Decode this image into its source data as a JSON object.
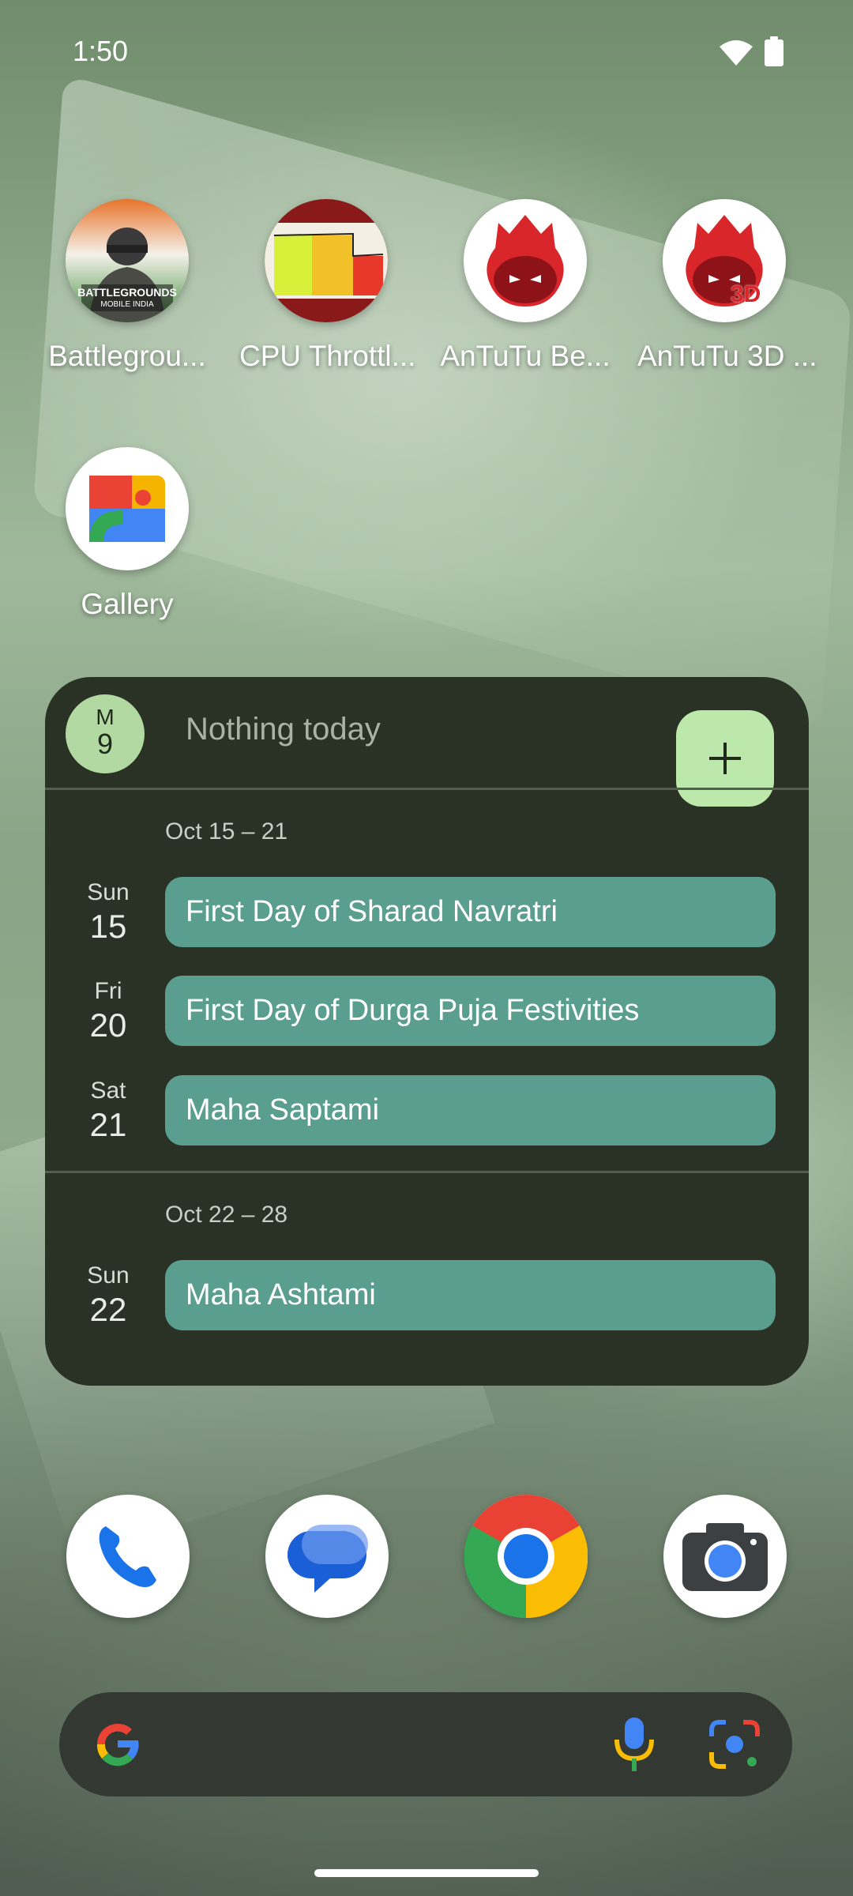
{
  "status_bar": {
    "time": "1:50"
  },
  "apps": [
    {
      "label": "Battlegrou...",
      "icon": "battlegrounds-icon",
      "icon_text_1": "BATTLEGROUNDS",
      "icon_text_2": "MOBILE INDIA"
    },
    {
      "label": "CPU Throttl...",
      "icon": "cpu-throttling-icon"
    },
    {
      "label": "AnTuTu Be...",
      "icon": "antutu-benchmark-icon"
    },
    {
      "label": "AnTuTu 3D ...",
      "icon": "antutu-3d-icon",
      "badge": "3D"
    },
    {
      "label": "Gallery",
      "icon": "gallery-icon"
    }
  ],
  "calendar": {
    "today_month": "M",
    "today_day": "9",
    "empty_text": "Nothing today",
    "add_icon": "plus-icon",
    "weeks": [
      {
        "range": "Oct 15 – 21",
        "days": [
          {
            "day_name": "Sun",
            "day_num": "15",
            "event": "First Day of Sharad Navratri"
          },
          {
            "day_name": "Fri",
            "day_num": "20",
            "event": "First Day of Durga Puja Festivities"
          },
          {
            "day_name": "Sat",
            "day_num": "21",
            "event": "Maha Saptami"
          }
        ]
      },
      {
        "range": "Oct 22 – 28",
        "days": [
          {
            "day_name": "Sun",
            "day_num": "22",
            "event": "Maha Ashtami"
          }
        ]
      }
    ],
    "colors": {
      "background": "#2a3125",
      "event": "#5a9e8f",
      "accent": "#bde8ab"
    }
  },
  "dock": [
    {
      "icon": "phone-icon"
    },
    {
      "icon": "messages-icon"
    },
    {
      "icon": "chrome-icon"
    },
    {
      "icon": "camera-icon"
    }
  ],
  "search": {
    "logo": "google-g-icon",
    "mic": "mic-icon",
    "lens": "lens-icon"
  }
}
